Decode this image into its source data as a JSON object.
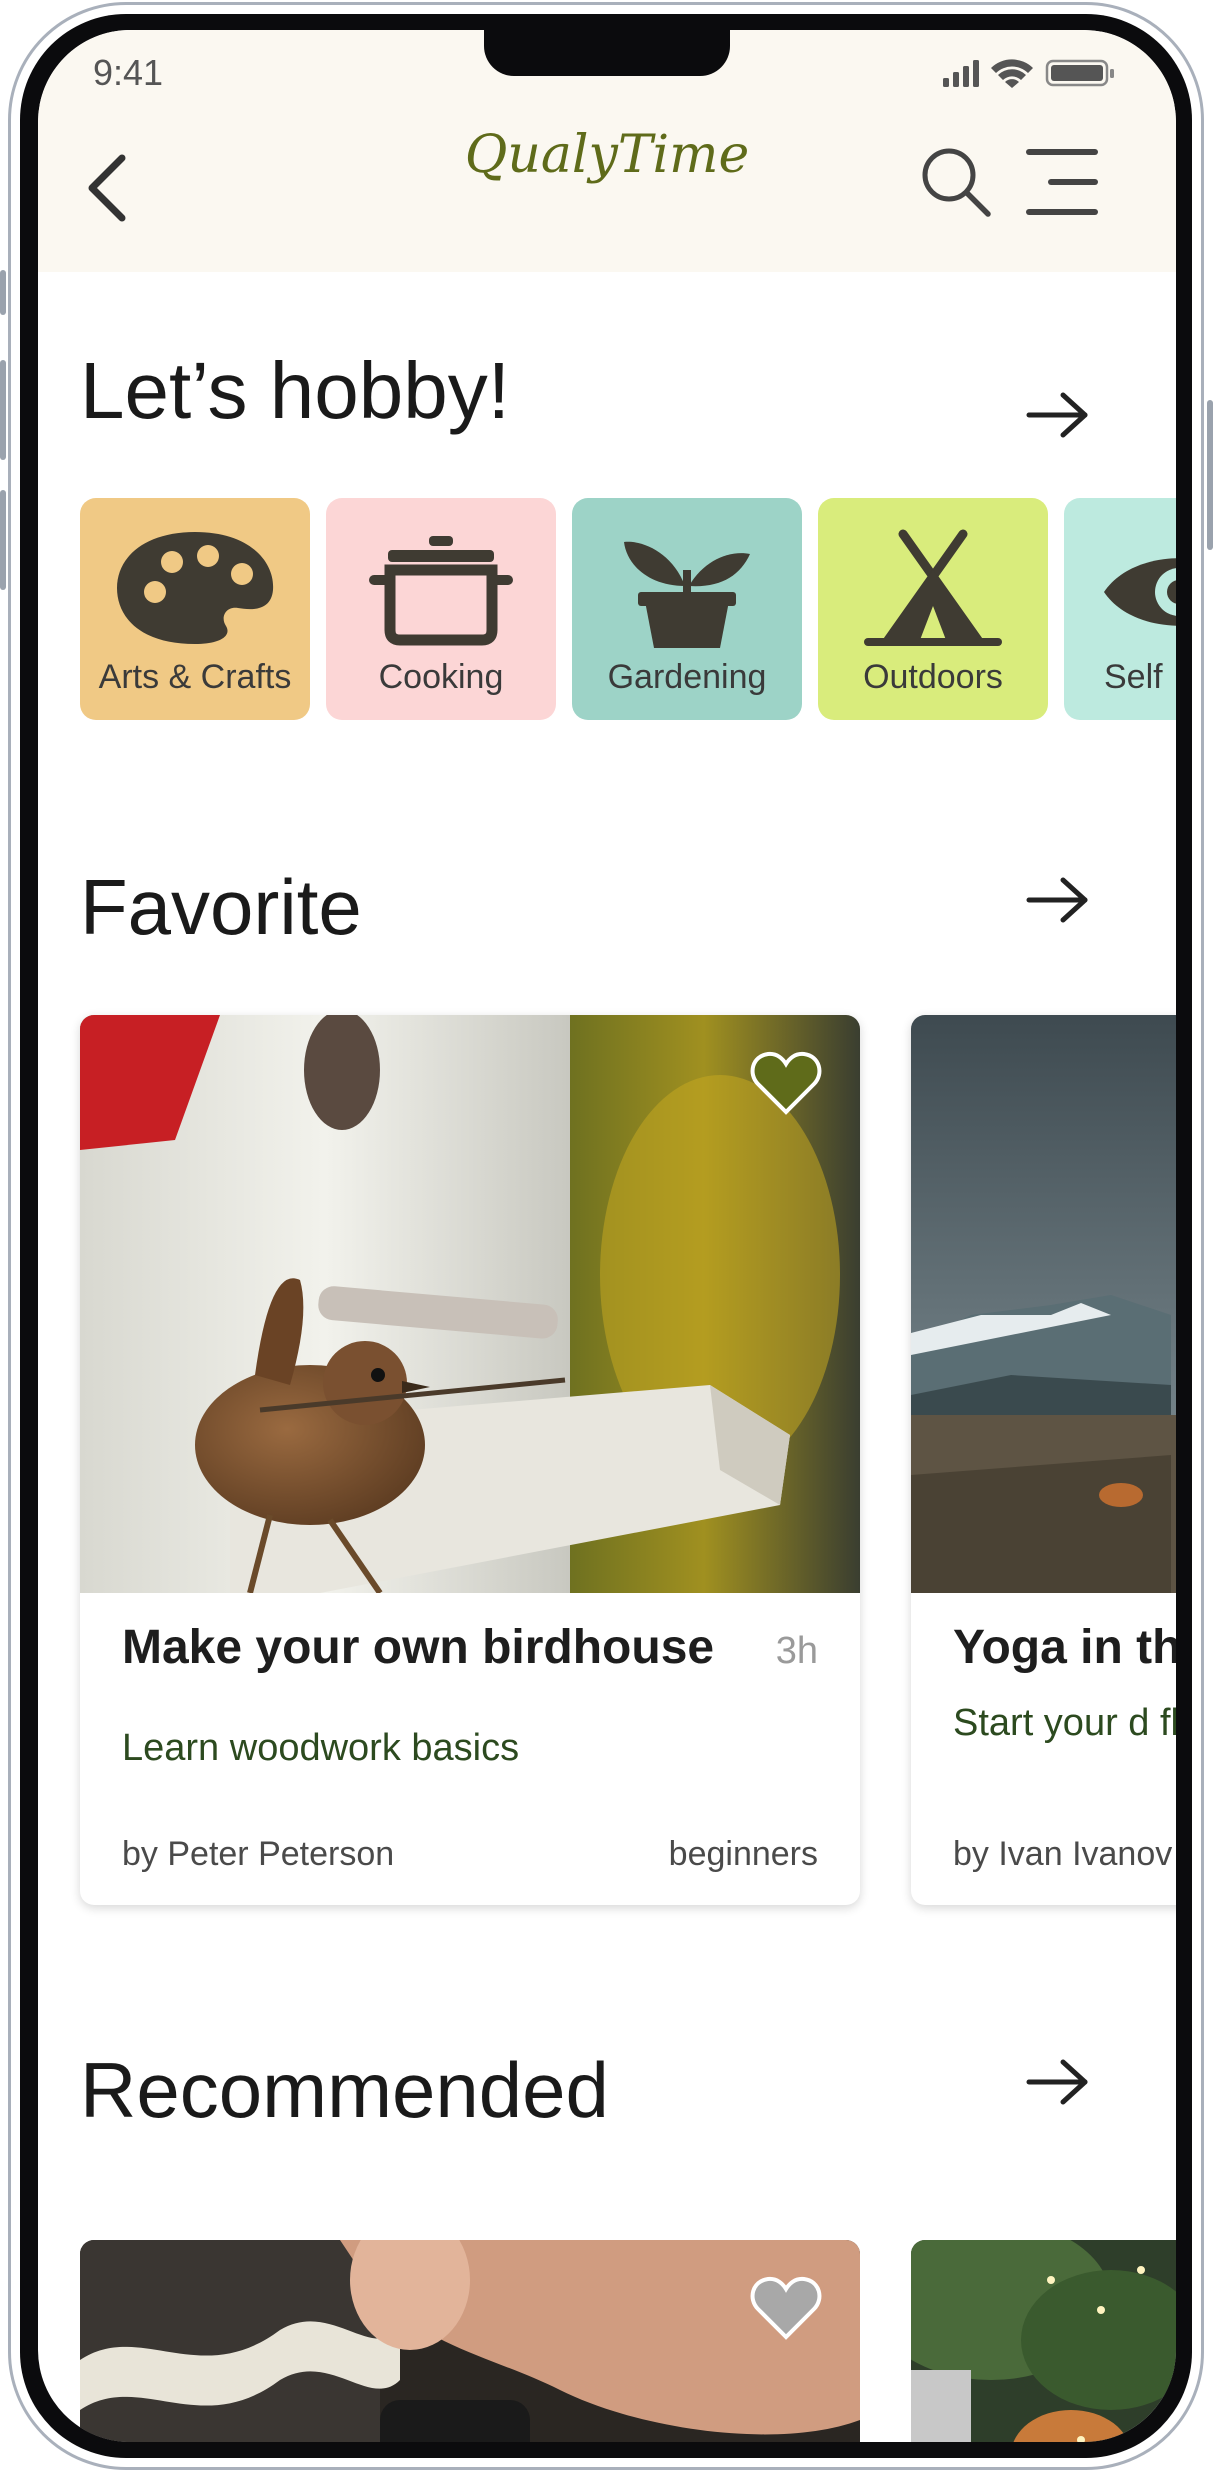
{
  "status": {
    "time": "9:41"
  },
  "app": {
    "title": "QualyTime"
  },
  "hobbies": {
    "title": "Let’s hobby!",
    "items": [
      {
        "label": "Arts & Crafts",
        "color": "#f0c985",
        "icon": "palette-icon"
      },
      {
        "label": "Cooking",
        "color": "#fcd6d6",
        "icon": "pot-icon"
      },
      {
        "label": "Gardening",
        "color": "#9dd3c7",
        "icon": "plant-icon"
      },
      {
        "label": "Outdoors",
        "color": "#d9ec7c",
        "icon": "tent-icon"
      },
      {
        "label": "Self",
        "color": "#bdeadf",
        "icon": "eye-icon"
      }
    ]
  },
  "favorite": {
    "title": "Favorite",
    "cards": [
      {
        "title": "Make your own birdhouse",
        "duration": "3h",
        "subtitle": "Learn woodwork basics",
        "author": "by Peter Peterson",
        "level": "beginners",
        "favorited": true
      },
      {
        "title": "Yoga in the",
        "subtitle": "Start your d flexibility",
        "author": "by Ivan Ivanov"
      }
    ]
  },
  "recommended": {
    "title": "Recommended"
  },
  "colors": {
    "accent": "#5f6b1a",
    "header_bg": "#fbf8f1",
    "subtitle_green": "#2c4a1f"
  }
}
